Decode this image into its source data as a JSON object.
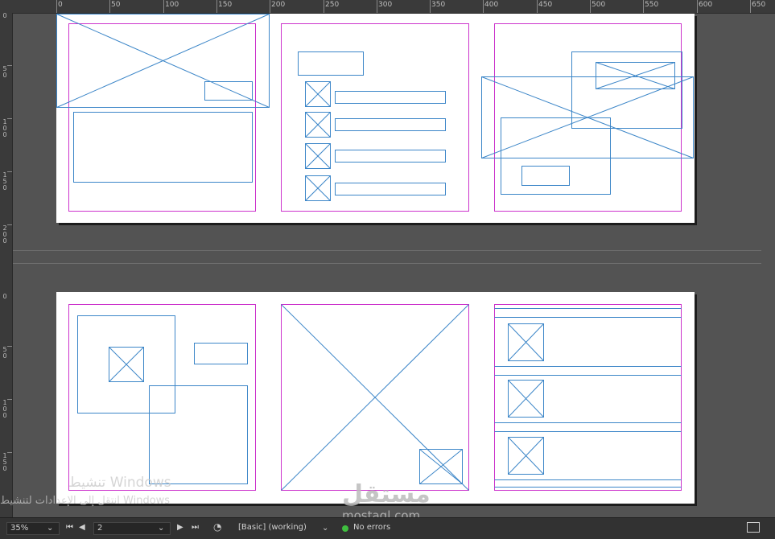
{
  "ruler": {
    "top_labels": [
      "0",
      "50",
      "100",
      "150",
      "200",
      "250",
      "300",
      "350",
      "400",
      "450",
      "500",
      "550",
      "600",
      "650"
    ],
    "left_labels_spread1": [
      "0",
      "5",
      "0",
      "1",
      "0",
      "0",
      "1",
      "5",
      "0",
      "2",
      "0",
      "0"
    ],
    "left_labels_spread2": [
      "0",
      "5",
      "0",
      "1",
      "0",
      "0",
      "1",
      "5",
      "0"
    ]
  },
  "status_bar": {
    "zoom": "35%",
    "page": "2",
    "preflight_profile": "[Basic] (working)",
    "errors": "No errors"
  },
  "watermark": {
    "line1": "تنشيط Windows",
    "line2": "انتقل إلى الإعدادات لتنشيط Windows"
  },
  "brand_overlay": {
    "arabic": "مستقل",
    "latin": "mostaql.com"
  },
  "colors": {
    "margin_guide": "#cc33cc",
    "frame": "#3c86c8",
    "pasteboard": "#535353"
  }
}
